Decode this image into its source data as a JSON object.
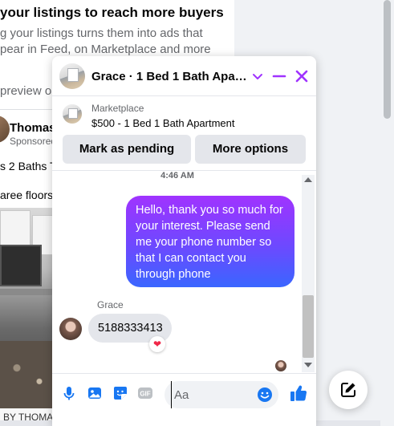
{
  "feed": {
    "promo_title": "your listings to reach more buyers",
    "promo_desc_lines": [
      "g your listings turns them into ads that",
      "pear in Feed, on Marketplace and more"
    ],
    "preview_link": "preview o",
    "post_author": "Thomas",
    "post_sponsored": "Sponsored",
    "post_line1": "s 2 Baths T",
    "post_line2": "aree floors",
    "photo_caption": "BY THOMA"
  },
  "chat": {
    "header_title": "Grace · 1 Bed 1 Bath Apart...",
    "listing_source": "Marketplace",
    "listing_title": "$500 - 1 Bed 1 Bath Apartment",
    "buttons": {
      "mark_pending": "Mark as pending",
      "more_options": "More options"
    },
    "timestamp": "4:46 AM",
    "outgoing_message": "Hello, thank you so much for your interest. Please send me your phone number so that I can contact you through phone",
    "sender_name": "Grace",
    "incoming_message": "5188333413",
    "reaction": "❤",
    "composer_placeholder": "Aa"
  },
  "colors": {
    "accent": "#a033ff",
    "bubble_gradient": [
      "#a033ff",
      "#6d49ff",
      "#3a66ff"
    ],
    "icon_blue": "#1877f2",
    "heart": "#f02849"
  },
  "icons": [
    "chevron-down-icon",
    "minimize-icon",
    "close-icon",
    "microphone-icon",
    "photo-icon",
    "sticker-icon",
    "gif-icon",
    "emoji-icon",
    "thumbs-up-icon",
    "new-message-icon",
    "heart-icon"
  ]
}
